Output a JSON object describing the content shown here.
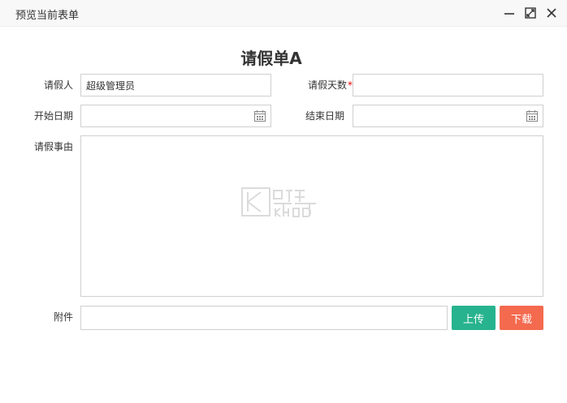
{
  "window": {
    "title": "预览当前表单"
  },
  "form": {
    "title": "请假单A",
    "fields": {
      "applicant": {
        "label": "请假人",
        "value": "超级管理员"
      },
      "days": {
        "label": "请假天数",
        "required_mark": "*",
        "value": ""
      },
      "start_date": {
        "label": "开始日期",
        "value": ""
      },
      "end_date": {
        "label": "结束日期",
        "value": ""
      },
      "reason": {
        "label": "请假事由",
        "value": ""
      },
      "attachment": {
        "label": "附件",
        "value": ""
      }
    },
    "buttons": {
      "upload": "上传",
      "download": "下载"
    }
  },
  "colors": {
    "upload": "#27b38e",
    "download": "#f46a4f",
    "required": "#ee0000"
  },
  "icons": {
    "minimize": "minimize-icon",
    "maximize": "maximize-icon",
    "close": "close-icon",
    "calendar": "calendar-icon",
    "watermark": "khod-watermark-logo"
  }
}
